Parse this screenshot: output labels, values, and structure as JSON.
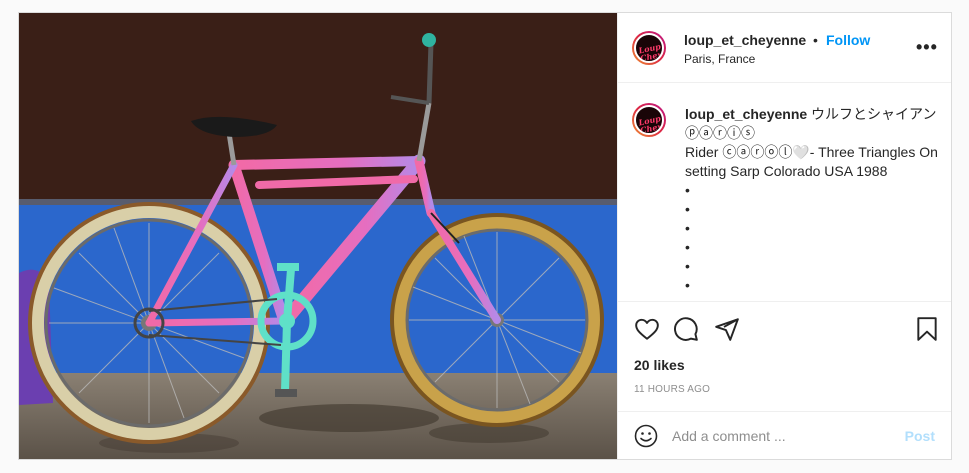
{
  "post": {
    "username": "loup_et_cheyenne",
    "separator": "•",
    "follow_label": "Follow",
    "location": "Paris, France",
    "avatar_text": "Loup et Cheyenne",
    "more_label": "•••",
    "photo_alt": "Pink and purple bicycle leaning against a blue and brown wall"
  },
  "caption": {
    "username": "loup_et_cheyenne",
    "line1": "ウルフとシャイアン",
    "line2": "ⓟⓐⓡⓘⓢ",
    "line3": "Rider ⓒⓐⓡⓞⓛ🤍- Three Triangles On setting Sarp Colorado USA 1988",
    "bullets": [
      "•",
      "•",
      "•",
      "•",
      "•",
      "•",
      "•"
    ]
  },
  "actions": {
    "like_icon": "heart-icon",
    "comment_icon": "comment-icon",
    "share_icon": "share-icon",
    "save_icon": "bookmark-icon",
    "likes": "20 likes",
    "time": "11 HOURS AGO"
  },
  "comment_box": {
    "emoji_icon": "smiley-icon",
    "placeholder": "Add a comment ...",
    "post_label": "Post"
  },
  "colors": {
    "follow": "#0095f6",
    "post_disabled": "#b2dffc",
    "wall_blue": "#2f6fd6",
    "wall_brown": "#3a1f17",
    "frame_pink": "#f06aa8",
    "frame_purple": "#b48ae8",
    "crank_teal": "#5fe0c8"
  }
}
